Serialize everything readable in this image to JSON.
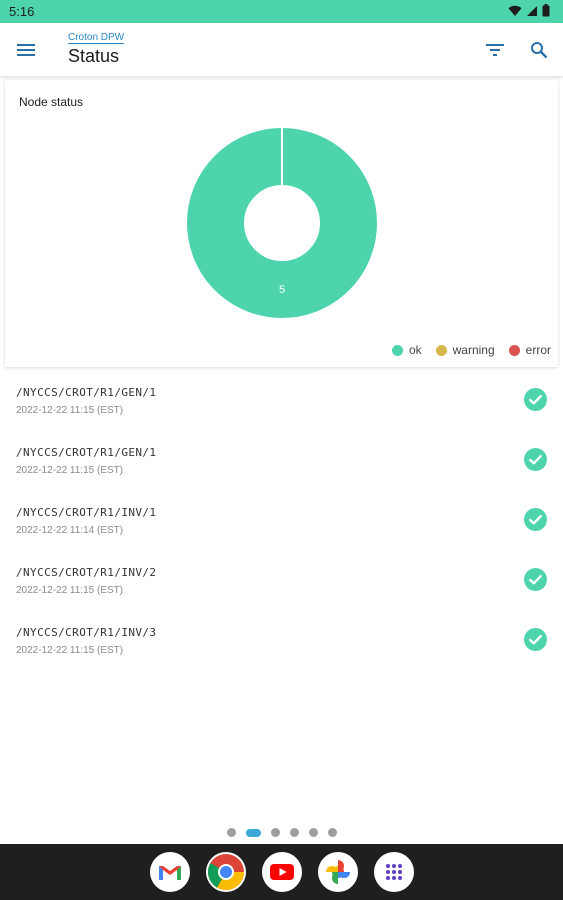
{
  "status_bar": {
    "time": "5:16",
    "icons": [
      "wifi-icon",
      "cellular-icon",
      "battery-icon"
    ]
  },
  "app_bar": {
    "subtitle": "Croton DPW",
    "title": "Status",
    "icons": [
      "menu-icon",
      "filter-icon",
      "search-icon"
    ]
  },
  "chart_card": {
    "title": "Node status",
    "chart_data": {
      "type": "pie",
      "categories": [
        "ok",
        "warning",
        "error"
      ],
      "values": [
        5,
        0,
        0
      ],
      "colors": [
        "#4dd4ad",
        "#d4b64a",
        "#d9534f"
      ],
      "data_labels": [
        "5"
      ],
      "legend_position": "bottom-right"
    },
    "legend": [
      {
        "label": "ok",
        "color": "#4dd4ad"
      },
      {
        "label": "warning",
        "color": "#d4b64a"
      },
      {
        "label": "error",
        "color": "#d9534f"
      }
    ]
  },
  "nodes": [
    {
      "path": "/NYCCS/CROT/R1/GEN/1",
      "time": "2022-12-22 11:15 (EST)",
      "status": "ok"
    },
    {
      "path": "/NYCCS/CROT/R1/GEN/1",
      "time": "2022-12-22 11:15 (EST)",
      "status": "ok"
    },
    {
      "path": "/NYCCS/CROT/R1/INV/1",
      "time": "2022-12-22 11:14 (EST)",
      "status": "ok"
    },
    {
      "path": "/NYCCS/CROT/R1/INV/2",
      "time": "2022-12-22 11:15 (EST)",
      "status": "ok"
    },
    {
      "path": "/NYCCS/CROT/R1/INV/3",
      "time": "2022-12-22 11:15 (EST)",
      "status": "ok"
    }
  ],
  "page_indicator": {
    "count": 6,
    "active": 1
  },
  "dock": {
    "apps": [
      "gmail-icon",
      "chrome-icon",
      "youtube-icon",
      "photos-icon",
      "app-drawer-icon"
    ]
  },
  "colors": {
    "accent": "#4dd4ad",
    "link": "#2a86c5",
    "status_ok": "#4dd4ad"
  }
}
